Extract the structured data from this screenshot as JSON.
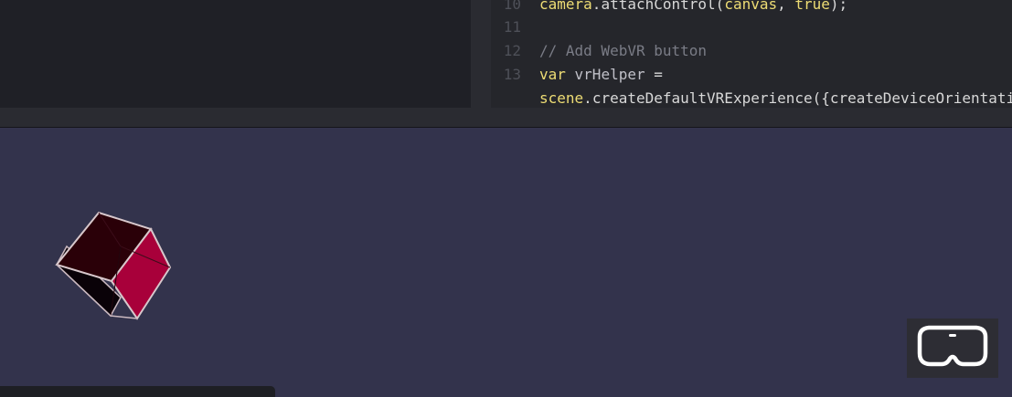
{
  "editor": {
    "lines": [
      {
        "number": "10",
        "tokens": [
          {
            "text": "camera",
            "kind": "obj"
          },
          {
            "text": ".",
            "kind": "punct"
          },
          {
            "text": "attachControl",
            "kind": "fn"
          },
          {
            "text": "(",
            "kind": "punct"
          },
          {
            "text": "canvas",
            "kind": "obj"
          },
          {
            "text": ", ",
            "kind": "punct"
          },
          {
            "text": "true",
            "kind": "kw"
          },
          {
            "text": ");",
            "kind": "punct"
          }
        ]
      },
      {
        "number": "11",
        "tokens": []
      },
      {
        "number": "12",
        "tokens": [
          {
            "text": "// Add WebVR button",
            "kind": "comment"
          }
        ]
      },
      {
        "number": "13",
        "tokens": [
          {
            "text": "var",
            "kind": "kw"
          },
          {
            "text": " vrHelper ",
            "kind": "var"
          },
          {
            "text": "=",
            "kind": "punct"
          }
        ]
      },
      {
        "number": "",
        "tokens": [
          {
            "text": "scene",
            "kind": "obj"
          },
          {
            "text": ".",
            "kind": "punct"
          },
          {
            "text": "createDefaultVRExperience",
            "kind": "fn"
          },
          {
            "text": "({",
            "kind": "punct"
          },
          {
            "text": "createDeviceOrientation",
            "kind": "fn"
          }
        ]
      }
    ]
  },
  "scene": {
    "background_color": "#33334c",
    "cube_colors": {
      "dark_face": "#2a0008",
      "light_face": "#a8003a",
      "edge": "#d8c8cc"
    }
  },
  "vr_button": {
    "icon": "vr-headset-icon"
  }
}
